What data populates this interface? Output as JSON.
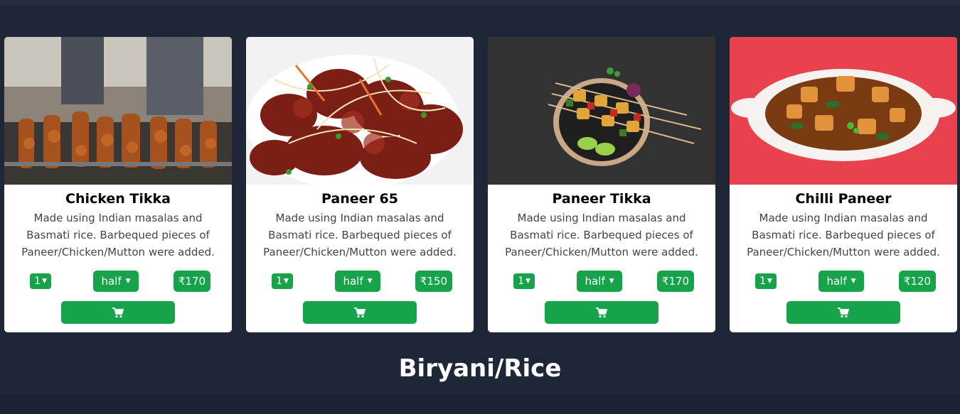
{
  "colors": {
    "background": "#1e2638",
    "accent": "#16a34a",
    "card": "#ffffff"
  },
  "cards": [
    {
      "title": "Chicken Tikka",
      "description": "Made using Indian masalas and Basmati rice. Barbequed pieces of Paneer/Chicken/Mutton were added.",
      "quantity": "1",
      "size": "half",
      "price": "₹170",
      "image": "chicken-tikka-skewers-on-grill",
      "cart_icon": "cart-icon"
    },
    {
      "title": "Paneer 65",
      "description": "Made using Indian masalas and Basmati rice. Barbequed pieces of Paneer/Chicken/Mutton were added.",
      "quantity": "1",
      "size": "half",
      "price": "₹150",
      "image": "paneer-65-plate",
      "cart_icon": "cart-icon"
    },
    {
      "title": "Paneer Tikka",
      "description": "Made using Indian masalas and Basmati rice. Barbequed pieces of Paneer/Chicken/Mutton were added.",
      "quantity": "1",
      "size": "half",
      "price": "₹170",
      "image": "paneer-tikka-skewers-bowl",
      "cart_icon": "cart-icon"
    },
    {
      "title": "Chilli Paneer",
      "description": "Made using Indian masalas and Basmati rice. Barbequed pieces of Paneer/Chicken/Mutton were added.",
      "quantity": "1",
      "size": "half",
      "price": "₹120",
      "image": "chilli-paneer-dish",
      "cart_icon": "cart-icon"
    }
  ],
  "section": {
    "title": "Biryani/Rice"
  }
}
